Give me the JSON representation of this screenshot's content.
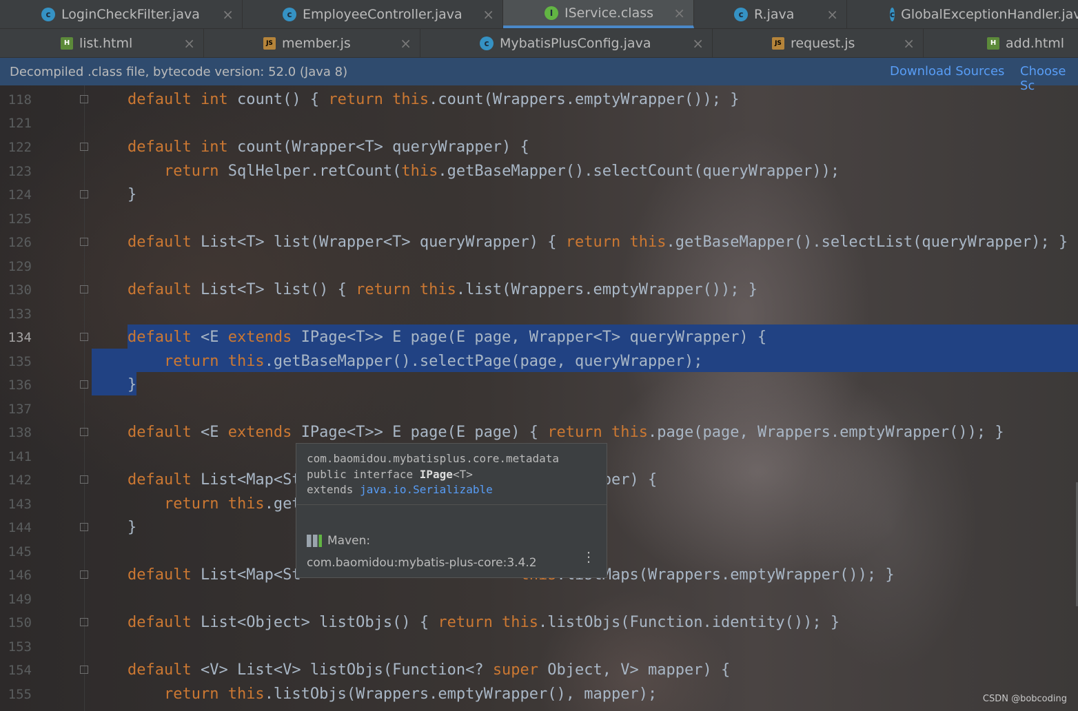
{
  "tabs_row1": [
    {
      "label": "LoginCheckFilter.java",
      "icon": "c"
    },
    {
      "label": "EmployeeController.java",
      "icon": "c"
    },
    {
      "label": "IService.class",
      "icon": "i",
      "active": true
    },
    {
      "label": "R.java",
      "icon": "c"
    },
    {
      "label": "GlobalExceptionHandler.java",
      "icon": "c"
    }
  ],
  "tabs_row2": [
    {
      "label": "list.html",
      "icon": "h"
    },
    {
      "label": "member.js",
      "icon": "js"
    },
    {
      "label": "MybatisPlusConfig.java",
      "icon": "c"
    },
    {
      "label": "request.js",
      "icon": "js"
    },
    {
      "label": "add.html",
      "icon": "h"
    }
  ],
  "banner": {
    "text": "Decompiled .class file, bytecode version: 52.0 (Java 8)",
    "download": "Download Sources",
    "choose": "Choose Sc"
  },
  "code_lines": [
    {
      "n": "118",
      "fold": "plus",
      "html": "<span class='kw'>default int</span> count() { <span class='kw'>return this</span>.count(Wrappers.emptyWrapper()); }"
    },
    {
      "n": "121",
      "fold": "",
      "html": ""
    },
    {
      "n": "122",
      "fold": "open",
      "html": "<span class='kw'>default int</span> count(Wrapper&lt;T&gt; queryWrapper) {"
    },
    {
      "n": "123",
      "fold": "",
      "html": "    <span class='kw'>return</span> SqlHelper.retCount(<span class='kw'>this</span>.getBaseMapper().selectCount(queryWrapper));"
    },
    {
      "n": "124",
      "fold": "close",
      "html": "}"
    },
    {
      "n": "125",
      "fold": "",
      "html": ""
    },
    {
      "n": "126",
      "fold": "plus",
      "html": "<span class='kw'>default</span> List&lt;T&gt; list(Wrapper&lt;T&gt; queryWrapper) { <span class='kw'>return this</span>.getBaseMapper().selectList(queryWrapper); }"
    },
    {
      "n": "129",
      "fold": "",
      "html": ""
    },
    {
      "n": "130",
      "fold": "plus",
      "html": "<span class='kw'>default</span> List&lt;T&gt; list() { <span class='kw'>return this</span>.list(Wrappers.emptyWrapper()); }"
    },
    {
      "n": "133",
      "fold": "",
      "html": ""
    },
    {
      "n": "134",
      "fold": "open",
      "html": "<span class='kw'>default</span> &lt;E <span class='kw'>extends</span> IPage&lt;T&gt;&gt; E page(E page, Wrapper&lt;T&gt; queryWrapper) {"
    },
    {
      "n": "135",
      "fold": "",
      "html": "    <span class='kw'>return this</span>.getBaseMapper().selectPage(page, queryWrapper);"
    },
    {
      "n": "136",
      "fold": "close",
      "html": "}"
    },
    {
      "n": "137",
      "fold": "",
      "html": ""
    },
    {
      "n": "138",
      "fold": "plus",
      "html": "<span class='kw'>default</span> &lt;E <span class='kw'>extends</span> IPage&lt;T&gt;&gt; E page(E page) { <span class='kw'>return this</span>.page(page, Wrappers.emptyWrapper()); }"
    },
    {
      "n": "141",
      "fold": "",
      "html": ""
    },
    {
      "n": "142",
      "fold": "open",
      "html": "<span class='kw'>default</span> List&lt;Map&lt;St                        queryWrapper) {"
    },
    {
      "n": "143",
      "fold": "",
      "html": "    <span class='kw'>return this</span>.get                         er);"
    },
    {
      "n": "144",
      "fold": "close",
      "html": "}"
    },
    {
      "n": "145",
      "fold": "",
      "html": ""
    },
    {
      "n": "146",
      "fold": "plus",
      "html": "<span class='kw'>default</span> List&lt;Map&lt;St                        <span class='kw'>this</span>.listMaps(Wrappers.emptyWrapper()); }"
    },
    {
      "n": "149",
      "fold": "",
      "html": ""
    },
    {
      "n": "150",
      "fold": "plus",
      "html": "<span class='kw'>default</span> List&lt;Object&gt; listObjs() { <span class='kw'>return this</span>.listObjs(Function.identity()); }"
    },
    {
      "n": "153",
      "fold": "",
      "html": ""
    },
    {
      "n": "154",
      "fold": "open",
      "html": "<span class='kw'>default</span> &lt;V&gt; List&lt;V&gt; listObjs(Function&lt;? <span class='kw'>super</span> Object, V&gt; mapper) {"
    },
    {
      "n": "155",
      "fold": "",
      "html": "    <span class='kw'>return this</span>.listObjs(Wrappers.emptyWrapper(), mapper);"
    }
  ],
  "tooltip": {
    "package": "com.baomidou.mybatisplus.core.metadata",
    "decl_prefix": "public interface ",
    "decl_name": "IPage",
    "decl_suffix": "<T>",
    "extends_prefix": "extends ",
    "extends_link": "java.io.Serializable",
    "maven_label": "Maven:",
    "coordinate": "com.baomidou:mybatis-plus-core:3.4.2"
  },
  "watermark": "CSDN @bobcoding"
}
